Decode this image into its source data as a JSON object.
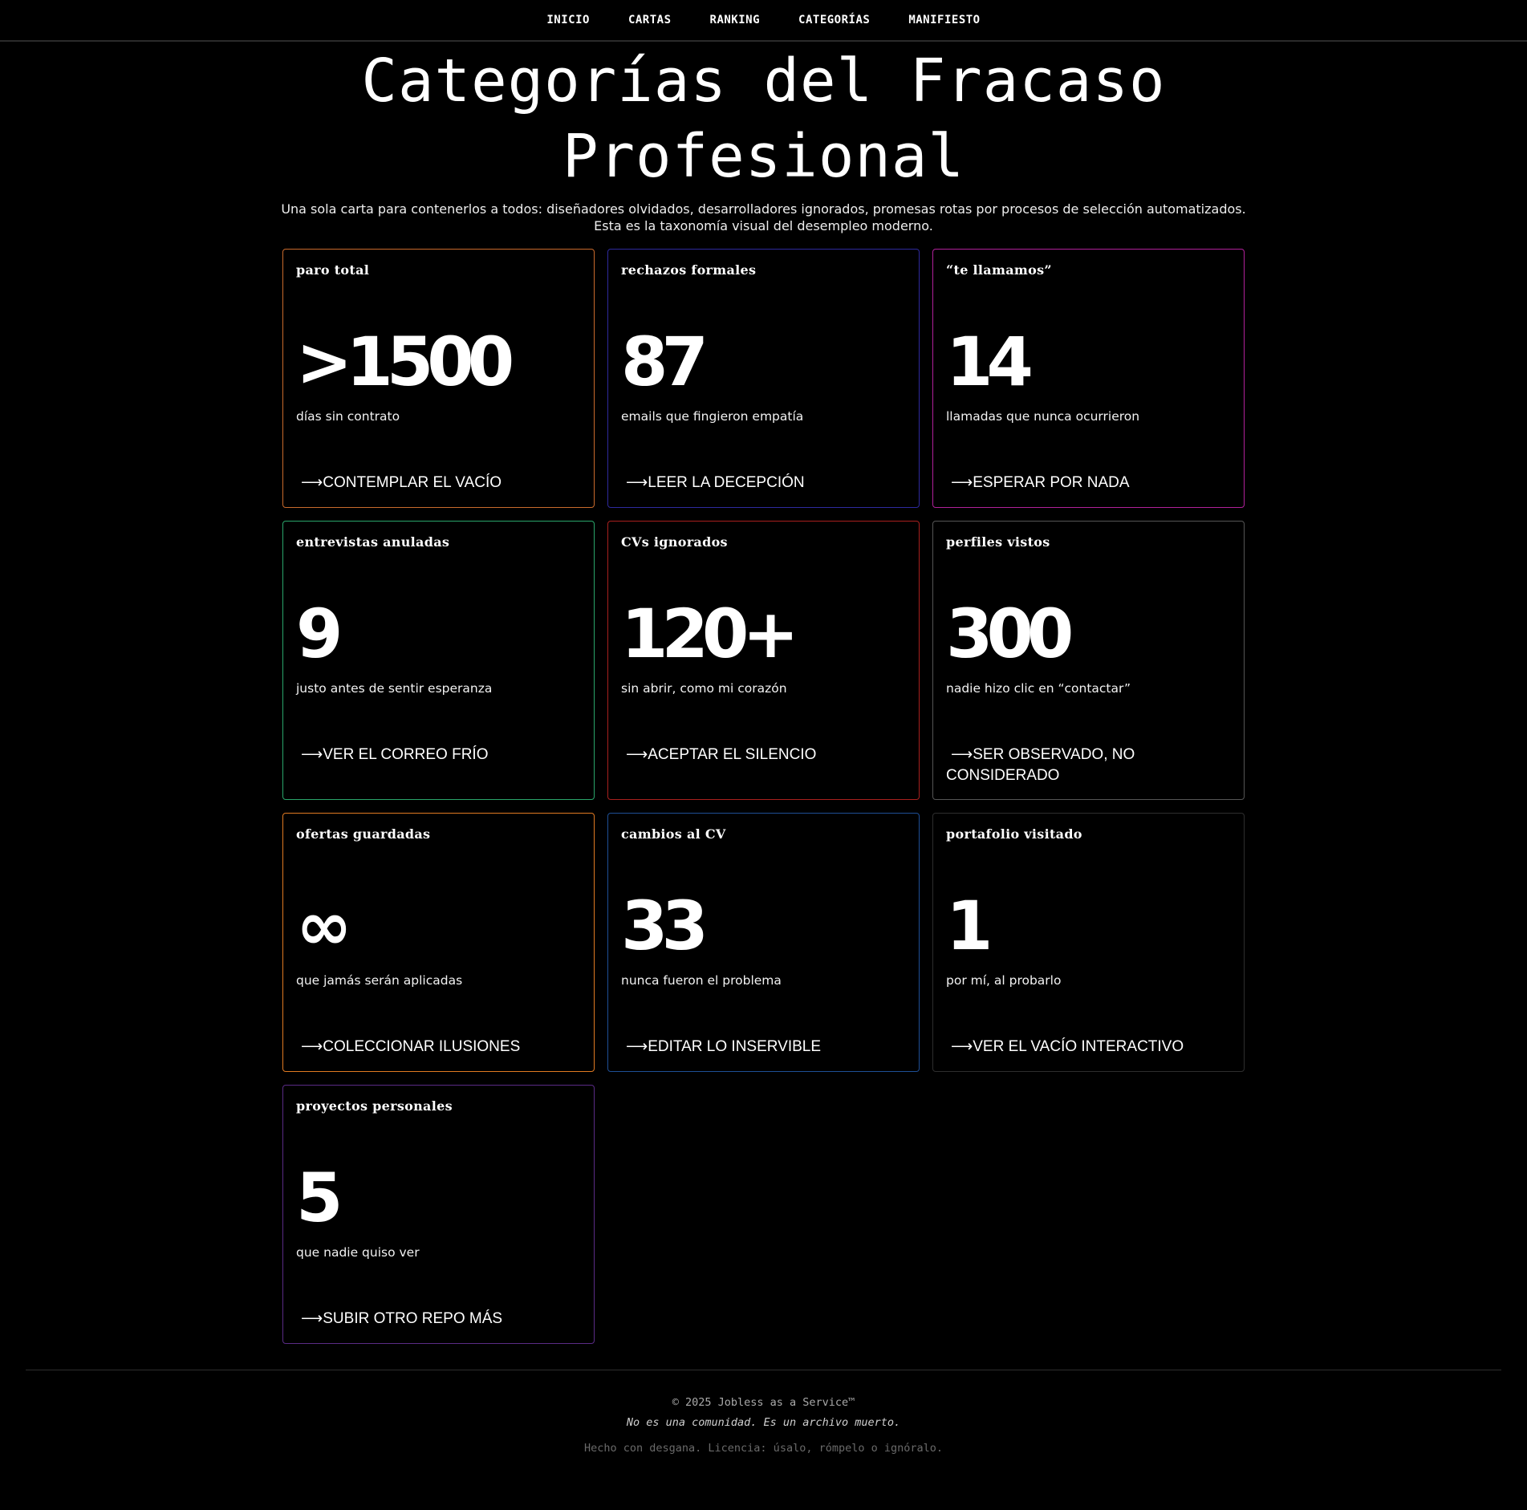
{
  "nav": {
    "items": [
      {
        "label": "INICIO"
      },
      {
        "label": "CARTAS"
      },
      {
        "label": "RANKING"
      },
      {
        "label": "CATEGORÍAS"
      },
      {
        "label": "MANIFIESTO"
      }
    ]
  },
  "header": {
    "title": "Categorías del Fracaso Profesional",
    "subtitle": "Una sola carta para contenerlos a todos: diseñadores olvidados, desarrolladores ignorados, promesas rotas por procesos de selección automatizados. Esta es la taxonomía visual del desempleo moderno."
  },
  "cards": [
    {
      "label": "paro total",
      "number": ">1500",
      "desc": "días sin contrato",
      "link": "CONTEMPLAR EL VACÍO",
      "border_color": "#c96a2c"
    },
    {
      "label": "rechazos formales",
      "number": "87",
      "desc": "emails que fingieron empatía",
      "link": "LEER LA DECEPCIÓN",
      "border_color": "#2e2a9e"
    },
    {
      "label": "“te llamamos”",
      "number": "14",
      "desc": "llamadas que nunca ocurrieron",
      "link": "ESPERAR POR NADA",
      "border_color": "#b0219a"
    },
    {
      "label": "entrevistas anuladas",
      "number": "9",
      "desc": "justo antes de sentir esperanza",
      "link": "VER EL CORREO FRÍO",
      "border_color": "#2aa56a"
    },
    {
      "label": "CVs ignorados",
      "number": "120+",
      "desc": "sin abrir, como mi corazón",
      "link": "ACEPTAR EL SILENCIO",
      "border_color": "#a8201e"
    },
    {
      "label": "perfiles vistos",
      "number": "300",
      "desc": "nadie hizo clic en “contactar”",
      "link": "SER OBSERVADO, NO CONSIDERADO",
      "border_color": "#555555"
    },
    {
      "label": "ofertas guardadas",
      "number": "∞",
      "desc": "que jamás serán aplicadas",
      "link": "COLECCIONAR ILUSIONES",
      "border_color": "#e07a22"
    },
    {
      "label": "cambios al CV",
      "number": "33",
      "desc": "nunca fueron el problema",
      "link": "EDITAR LO INSERVIBLE",
      "border_color": "#1e4f96"
    },
    {
      "label": "portafolio visitado",
      "number": "1",
      "desc": "por mí, al probarlo",
      "link": "VER EL VACÍO INTERACTIVO",
      "border_color": "#2e2e2e"
    },
    {
      "label": "proyectos personales",
      "number": "5",
      "desc": "que nadie quiso ver",
      "link": "SUBIR OTRO REPO MÁS",
      "border_color": "#5a2b86"
    }
  ],
  "link_arrow": "⟶",
  "footer": {
    "copyright": "© 2025 Jobless as a Service™",
    "tagline": "No es una comunidad. Es un archivo muerto.",
    "license": "Hecho con desgana. Licencia: úsalo, rómpelo o ignóralo."
  }
}
